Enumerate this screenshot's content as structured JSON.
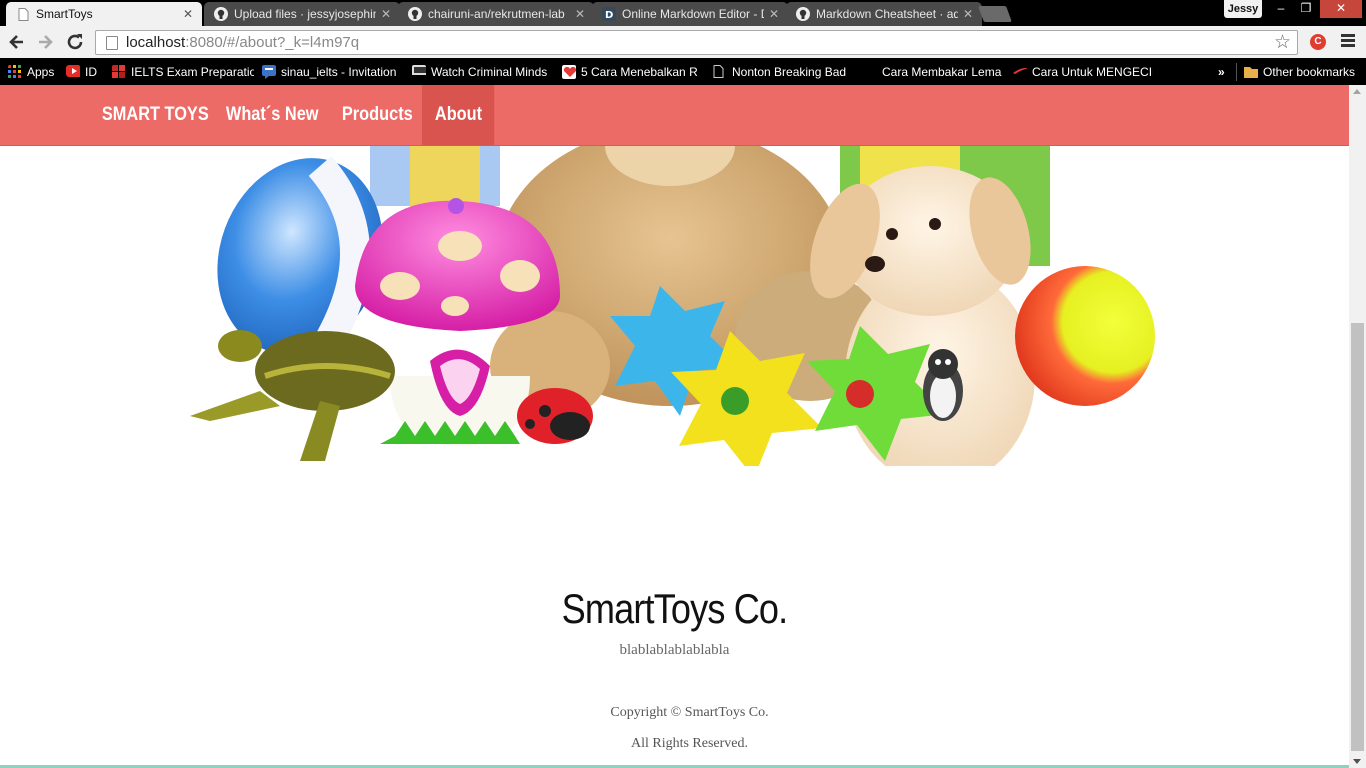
{
  "browser": {
    "tabs": [
      {
        "title": "SmartToys",
        "icon": "page-icon",
        "active": true
      },
      {
        "title": "Upload files · jessyjosephine",
        "icon": "github-icon",
        "active": false
      },
      {
        "title": "chairuni-an/rekrutmen-lab",
        "icon": "github-icon",
        "active": false
      },
      {
        "title": "Online Markdown Editor - D",
        "icon": "dillinger-icon",
        "active": false
      },
      {
        "title": "Markdown Cheatsheet · ad",
        "icon": "github-icon",
        "active": false
      }
    ],
    "profile_name": "Jessy",
    "window_controls": {
      "minimize": "–",
      "restore": "❐",
      "close": "✕"
    },
    "url_host": "localhost",
    "url_rest": ":8080/#/about?_k=l4m97q",
    "bookmarks": [
      {
        "label": "Apps",
        "icon": "apps-grid-icon",
        "color": "#e44134"
      },
      {
        "label": "ID",
        "icon": "youtube-icon",
        "color": "#e52d27"
      },
      {
        "label": "IELTS Exam Preparatio",
        "icon": "ielts-icon",
        "color": "#c62828"
      },
      {
        "label": "sinau_ielts - Invitation",
        "icon": "chat-icon",
        "color": "#3b73c8"
      },
      {
        "label": "Watch Criminal Minds",
        "icon": "tv-icon",
        "color": "#dddddd"
      },
      {
        "label": "5 Cara Menebalkan R",
        "icon": "heart-icon",
        "color": "#e53935"
      },
      {
        "label": "Nonton Breaking Bad",
        "icon": "page-icon",
        "color": "#000000"
      },
      {
        "label": "Cara Membakar Lema",
        "icon": "blank-icon",
        "color": "#000000"
      },
      {
        "label": "Cara Untuk MENGECIL",
        "icon": "swoosh-icon",
        "color": "#e53935"
      }
    ],
    "bookmarks_overflow": "»",
    "other_bookmarks": "Other bookmarks"
  },
  "site": {
    "brand": "SMART TOYS",
    "nav": [
      "What´s New",
      "Products",
      "About"
    ],
    "active_nav": "About",
    "nav_color": "#ec6b67",
    "active_color": "#d9534f",
    "company_name": "SmartToys Co.",
    "company_description": "blablablablablabla",
    "copyright": "Copyright © SmartToys Co.",
    "rights": "All Rights Reserved."
  }
}
